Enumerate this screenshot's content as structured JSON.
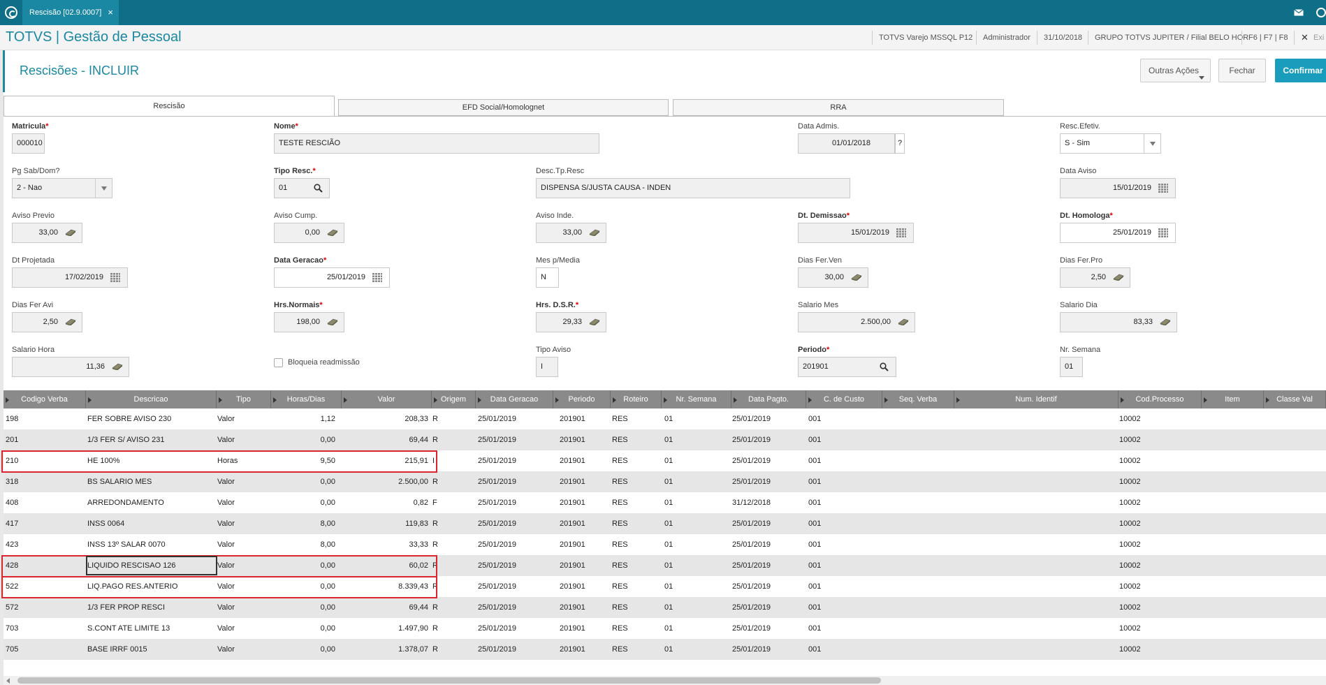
{
  "topbar": {
    "tab_label": "Rescisão [02.9.0007]",
    "tab_close": "×",
    "mail_icon": "envelope-icon",
    "help_icon": "help-icon"
  },
  "appbar": {
    "title": "TOTVS | Gestão de Pessoal",
    "environment": "TOTVS Varejo MSSQL P12",
    "user": "Administrador",
    "date": "31/10/2018",
    "company": "GRUPO TOTVS JUPITER / Filial BELO HOR",
    "shortcuts": "F6 | F7 | F8",
    "exit_label": "Exi"
  },
  "page": {
    "title": "Rescisões - INCLUIR",
    "other_actions": "Outras Ações",
    "close_label": "Fechar",
    "confirm_label": "Confirmar"
  },
  "tabs": [
    "Rescisão",
    "EFD Social/Homolognet",
    "RRA"
  ],
  "form": {
    "matricula": {
      "label": "Matricula",
      "value": "000010"
    },
    "nome": {
      "label": "Nome",
      "value": "TESTE RESCIÃO"
    },
    "data_admis": {
      "label": "Data Admis.",
      "value": "01/01/2018",
      "help": "?"
    },
    "resc_efetiv": {
      "label": "Resc.Efetiv.",
      "value": "S - Sim"
    },
    "pg_sab_dom": {
      "label": "Pg Sab/Dom?",
      "value": "2 - Nao"
    },
    "tipo_resc": {
      "label": "Tipo Resc.",
      "value": "01"
    },
    "desc_tp_resc": {
      "label": "Desc.Tp.Resc",
      "value": "DISPENSA S/JUSTA CAUSA - INDEN"
    },
    "data_aviso": {
      "label": "Data Aviso",
      "value": "15/01/2019"
    },
    "aviso_previo": {
      "label": "Aviso Previo",
      "value": "33,00"
    },
    "aviso_cump": {
      "label": "Aviso Cump.",
      "value": "0,00"
    },
    "aviso_inde": {
      "label": "Aviso Inde.",
      "value": "33,00"
    },
    "dt_demissao": {
      "label": "Dt. Demissao",
      "value": "15/01/2019"
    },
    "dt_homologa": {
      "label": "Dt. Homologa",
      "value": "25/01/2019"
    },
    "dt_projetada": {
      "label": "Dt Projetada",
      "value": "17/02/2019"
    },
    "data_geracao": {
      "label": "Data Geracao",
      "value": "25/01/2019"
    },
    "mes_p_media": {
      "label": "Mes p/Media",
      "value": "N"
    },
    "dias_fer_ven": {
      "label": "Dias Fer.Ven",
      "value": "30,00"
    },
    "dias_fer_pro": {
      "label": "Dias Fer.Pro",
      "value": "2,50"
    },
    "dias_fer_avi": {
      "label": "Dias Fer Avi",
      "value": "2,50"
    },
    "hrs_normais": {
      "label": "Hrs.Normais",
      "value": "198,00"
    },
    "hrs_dsr": {
      "label": "Hrs. D.S.R.",
      "value": "29,33"
    },
    "salario_mes": {
      "label": "Salario Mes",
      "value": "2.500,00"
    },
    "salario_dia": {
      "label": "Salario Dia",
      "value": "83,33"
    },
    "salario_hora": {
      "label": "Salario Hora",
      "value": "11,36"
    },
    "bloqueia": {
      "label": "Bloqueia readmissão"
    },
    "tipo_aviso": {
      "label": "Tipo Aviso",
      "value": "I"
    },
    "periodo": {
      "label": "Periodo",
      "value": "201901"
    },
    "nr_semana": {
      "label": "Nr. Semana",
      "value": "01"
    },
    "required_mark": "*"
  },
  "grid": {
    "columns": [
      "Codigo Verba",
      "Descricao",
      "Tipo",
      "Horas/Dias",
      "Valor",
      "Origem",
      "Data Geracao",
      "Periodo",
      "Roteiro",
      "Nr. Semana",
      "Data Pagto.",
      "C. de Custo",
      "Seq. Verba",
      "Num. Identif",
      "Cod.Processo",
      "Item",
      "Classe Val"
    ],
    "rows": [
      [
        "198",
        "FER SOBRE AVISO 230",
        "Valor",
        "1,12",
        "208,33",
        "R",
        "25/01/2019",
        "201901",
        "RES",
        "01",
        "25/01/2019",
        "001",
        "10002"
      ],
      [
        "201",
        "1/3 FER S/ AVISO 231",
        "Valor",
        "0,00",
        "69,44",
        "R",
        "25/01/2019",
        "201901",
        "RES",
        "01",
        "25/01/2019",
        "001",
        "10002"
      ],
      [
        "210",
        "HE 100%",
        "Horas",
        "9,50",
        "215,91",
        "I",
        "25/01/2019",
        "201901",
        "RES",
        "01",
        "25/01/2019",
        "001",
        "10002"
      ],
      [
        "318",
        "BS SALARIO MES",
        "Valor",
        "0,00",
        "2.500,00",
        "R",
        "25/01/2019",
        "201901",
        "RES",
        "01",
        "25/01/2019",
        "001",
        "10002"
      ],
      [
        "408",
        "ARREDONDAMENTO",
        "Valor",
        "0,00",
        "0,82",
        "F",
        "25/01/2019",
        "201901",
        "RES",
        "01",
        "31/12/2018",
        "001",
        "10002"
      ],
      [
        "417",
        "INSS 0064",
        "Valor",
        "8,00",
        "119,83",
        "R",
        "25/01/2019",
        "201901",
        "RES",
        "01",
        "25/01/2019",
        "001",
        "10002"
      ],
      [
        "423",
        "INSS 13º SALAR 0070",
        "Valor",
        "8,00",
        "33,33",
        "R",
        "25/01/2019",
        "201901",
        "RES",
        "01",
        "25/01/2019",
        "001",
        "10002"
      ],
      [
        "428",
        "LIQUIDO RESCISAO 126",
        "Valor",
        "0,00",
        "60,02",
        "R",
        "25/01/2019",
        "201901",
        "RES",
        "01",
        "25/01/2019",
        "001",
        "10002"
      ],
      [
        "522",
        "LIQ.PAGO RES.ANTERIO",
        "Valor",
        "0,00",
        "8.339,43",
        "R",
        "25/01/2019",
        "201901",
        "RES",
        "01",
        "25/01/2019",
        "001",
        "10002"
      ],
      [
        "572",
        "1/3 FER PROP RESCI",
        "Valor",
        "0,00",
        "69,44",
        "R",
        "25/01/2019",
        "201901",
        "RES",
        "01",
        "25/01/2019",
        "001",
        "10002"
      ],
      [
        "703",
        "S.CONT ATE LIMITE 13",
        "Valor",
        "0,00",
        "1.497,90",
        "R",
        "25/01/2019",
        "201901",
        "RES",
        "01",
        "25/01/2019",
        "001",
        "10002"
      ],
      [
        "705",
        "BASE IRRF 0015",
        "Valor",
        "0,00",
        "1.378,07",
        "R",
        "25/01/2019",
        "201901",
        "RES",
        "01",
        "25/01/2019",
        "001",
        "10002"
      ]
    ]
  },
  "colors": {
    "accent": "#1a87a3",
    "topbar": "#0f6f89",
    "highlight": "#d9262c",
    "header_gray": "#8a8a8a"
  }
}
